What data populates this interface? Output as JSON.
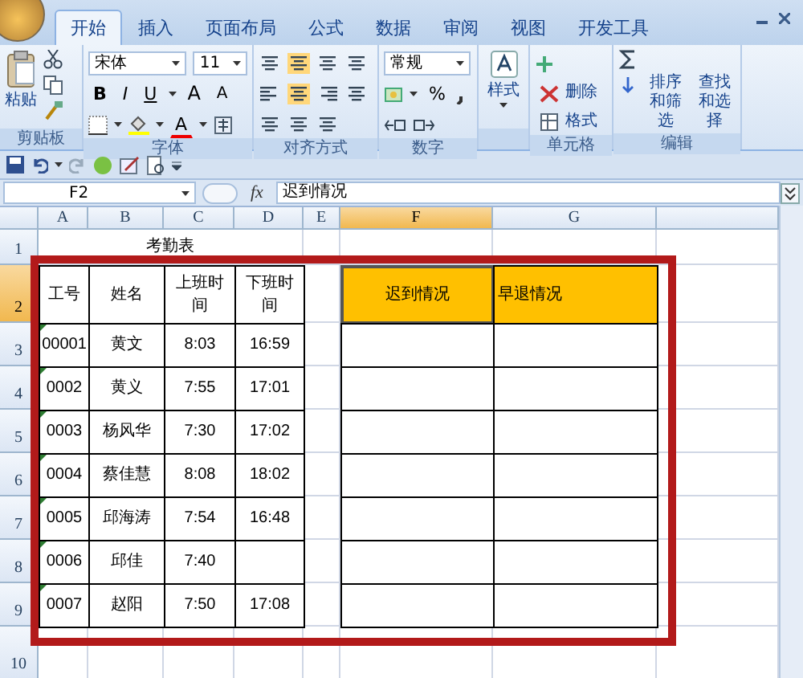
{
  "tabs": [
    {
      "label": "开始",
      "selected": true
    },
    {
      "label": "插入",
      "selected": false
    },
    {
      "label": "页面布局",
      "selected": false
    },
    {
      "label": "公式",
      "selected": false
    },
    {
      "label": "数据",
      "selected": false
    },
    {
      "label": "审阅",
      "selected": false
    },
    {
      "label": "视图",
      "selected": false
    },
    {
      "label": "开发工具",
      "selected": false
    }
  ],
  "ribbon": {
    "clipboard": {
      "paste": "粘贴",
      "label": "剪贴板"
    },
    "font": {
      "name": "宋体",
      "size": "11",
      "bold": "B",
      "italic": "I",
      "underline": "U",
      "grow": "A",
      "shrink": "A",
      "font_color_button": "A",
      "label": "字体"
    },
    "alignment": {
      "label": "对齐方式"
    },
    "number": {
      "format": "常规",
      "percent": "%",
      "label": "数字"
    },
    "styles": {
      "button": "样式"
    },
    "cells": {
      "delete": "删除",
      "format": "格式",
      "label": "单元格"
    },
    "editing": {
      "sort": "排序和筛选",
      "find": "查找和选择",
      "label": "编辑"
    }
  },
  "formula_bar": {
    "name_box": "F2",
    "fx": "fx",
    "formula": "迟到情况"
  },
  "sheet": {
    "columns": [
      {
        "label": "A",
        "selected": false
      },
      {
        "label": "B",
        "selected": false
      },
      {
        "label": "C",
        "selected": false
      },
      {
        "label": "D",
        "selected": false
      },
      {
        "label": "E",
        "selected": false
      },
      {
        "label": "F",
        "selected": true
      },
      {
        "label": "G",
        "selected": false
      }
    ],
    "rows": [
      {
        "label": "1",
        "selected": false,
        "cells": [
          {
            "kind": "title",
            "text": "考勤表"
          },
          {
            "kind": "merged"
          },
          {
            "kind": "merged"
          },
          {
            "kind": "merged"
          },
          {
            "kind": "plain"
          },
          {
            "kind": "plain"
          },
          {
            "kind": "plain"
          }
        ]
      },
      {
        "label": "2",
        "selected": true,
        "cells": [
          {
            "kind": "table",
            "text": "工号"
          },
          {
            "kind": "table",
            "text": "姓名"
          },
          {
            "kind": "table",
            "text": "上班时间"
          },
          {
            "kind": "table",
            "text": "下班时间"
          },
          {
            "kind": "plain"
          },
          {
            "kind": "table",
            "text": "迟到情况",
            "color": "#ffc000",
            "active": true
          },
          {
            "kind": "table",
            "text": "早退情况",
            "color": "#ffc000",
            "left_aligned": true
          }
        ]
      },
      {
        "label": "3",
        "selected": false,
        "cells": [
          {
            "kind": "table",
            "text": "00001",
            "flag": true
          },
          {
            "kind": "table",
            "text": "黄文"
          },
          {
            "kind": "table",
            "text": "8:03"
          },
          {
            "kind": "table",
            "text": "16:59"
          },
          {
            "kind": "plain"
          },
          {
            "kind": "table"
          },
          {
            "kind": "table"
          }
        ]
      },
      {
        "label": "4",
        "selected": false,
        "cells": [
          {
            "kind": "table",
            "text": "0002",
            "flag": true
          },
          {
            "kind": "table",
            "text": "黄义"
          },
          {
            "kind": "table",
            "text": "7:55"
          },
          {
            "kind": "table",
            "text": "17:01"
          },
          {
            "kind": "plain"
          },
          {
            "kind": "table"
          },
          {
            "kind": "table"
          }
        ]
      },
      {
        "label": "5",
        "selected": false,
        "cells": [
          {
            "kind": "table",
            "text": "0003",
            "flag": true
          },
          {
            "kind": "table",
            "text": "杨风华"
          },
          {
            "kind": "table",
            "text": "7:30"
          },
          {
            "kind": "table",
            "text": "17:02"
          },
          {
            "kind": "plain"
          },
          {
            "kind": "table"
          },
          {
            "kind": "table"
          }
        ]
      },
      {
        "label": "6",
        "selected": false,
        "cells": [
          {
            "kind": "table",
            "text": "0004",
            "flag": true
          },
          {
            "kind": "table",
            "text": "蔡佳慧"
          },
          {
            "kind": "table",
            "text": "8:08"
          },
          {
            "kind": "table",
            "text": "18:02"
          },
          {
            "kind": "plain"
          },
          {
            "kind": "table"
          },
          {
            "kind": "table"
          }
        ]
      },
      {
        "label": "7",
        "selected": false,
        "cells": [
          {
            "kind": "table",
            "text": "0005",
            "flag": true
          },
          {
            "kind": "table",
            "text": "邱海涛"
          },
          {
            "kind": "table",
            "text": "7:54"
          },
          {
            "kind": "table",
            "text": "16:48"
          },
          {
            "kind": "plain"
          },
          {
            "kind": "table"
          },
          {
            "kind": "table"
          }
        ]
      },
      {
        "label": "8",
        "selected": false,
        "cells": [
          {
            "kind": "table",
            "text": "0006",
            "flag": true
          },
          {
            "kind": "table",
            "text": "邱佳"
          },
          {
            "kind": "table",
            "text": "7:40"
          },
          {
            "kind": "table"
          },
          {
            "kind": "plain"
          },
          {
            "kind": "table"
          },
          {
            "kind": "table"
          }
        ]
      },
      {
        "label": "9",
        "selected": false,
        "cells": [
          {
            "kind": "table",
            "text": "0007",
            "flag": true
          },
          {
            "kind": "table",
            "text": "赵阳"
          },
          {
            "kind": "table",
            "text": "7:50"
          },
          {
            "kind": "table",
            "text": "17:08"
          },
          {
            "kind": "plain"
          },
          {
            "kind": "table"
          },
          {
            "kind": "table"
          }
        ]
      },
      {
        "label": "10",
        "selected": false
      }
    ]
  }
}
